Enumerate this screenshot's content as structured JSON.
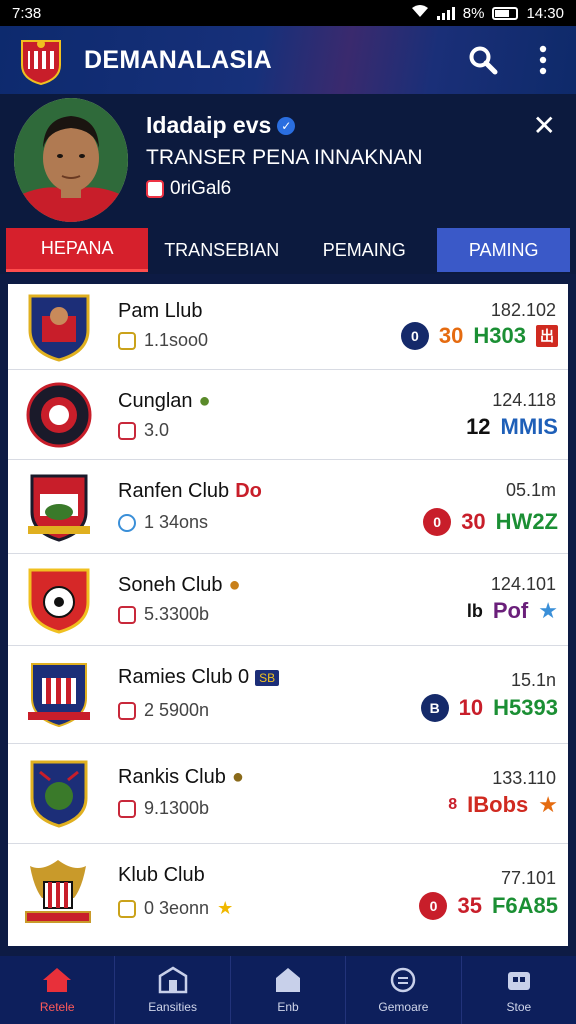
{
  "status_bar": {
    "time": "7:38",
    "battery": "8%",
    "clock": "14:30"
  },
  "app": {
    "title": "DEMANALASIA"
  },
  "profile": {
    "name": "Idadaip evs",
    "subtitle": "TRANSER PENA INNAKNAN",
    "meta": "0riGal6"
  },
  "tabs": [
    {
      "label": "HEPANA"
    },
    {
      "label": "TRANSEBIAN"
    },
    {
      "label": "PEMAING"
    },
    {
      "label": "PAMING"
    }
  ],
  "clubs": [
    {
      "name": "Pam Llub",
      "sub": "1.1soo0",
      "value": "182.102",
      "badge": "0",
      "num": "30",
      "code": "H303",
      "code_tail": "出"
    },
    {
      "name": "Cunglan",
      "sub": "3.0",
      "value": "124.118",
      "num": "12",
      "code": "MMIS"
    },
    {
      "name": "Ranfen Club",
      "name_tag": "Do",
      "sub": "1 34ons",
      "value": "05.1m",
      "badge": "0",
      "num": "30",
      "code": "HW2Z"
    },
    {
      "name": "Soneh Club",
      "sub": "5.3300b",
      "value": "124.101",
      "num": "lb",
      "code": "Pof"
    },
    {
      "name": "Ramies Club 0",
      "name_tag": "SB",
      "sub": "2 5900n",
      "value": "15.1n",
      "badge": "B",
      "num": "10",
      "code": "H5393"
    },
    {
      "name": "Rankis Club",
      "sub": "9.1300b",
      "value": "133.110",
      "num": "8",
      "code": "IBobs"
    },
    {
      "name": "Klub Club",
      "sub": "0 3eonn",
      "value": "77.101",
      "badge": "0",
      "num": "35",
      "code": "F6A85"
    }
  ],
  "bottom_nav": [
    {
      "label": "Retele"
    },
    {
      "label": "Eansities"
    },
    {
      "label": "Enb"
    },
    {
      "label": "Gemoare"
    },
    {
      "label": "Stoe"
    }
  ],
  "colors": {
    "header": "#0d2a6e",
    "tab_active": "#d6202c",
    "tab_highlight": "#3a59c8",
    "nav": "#0d1f5c"
  }
}
